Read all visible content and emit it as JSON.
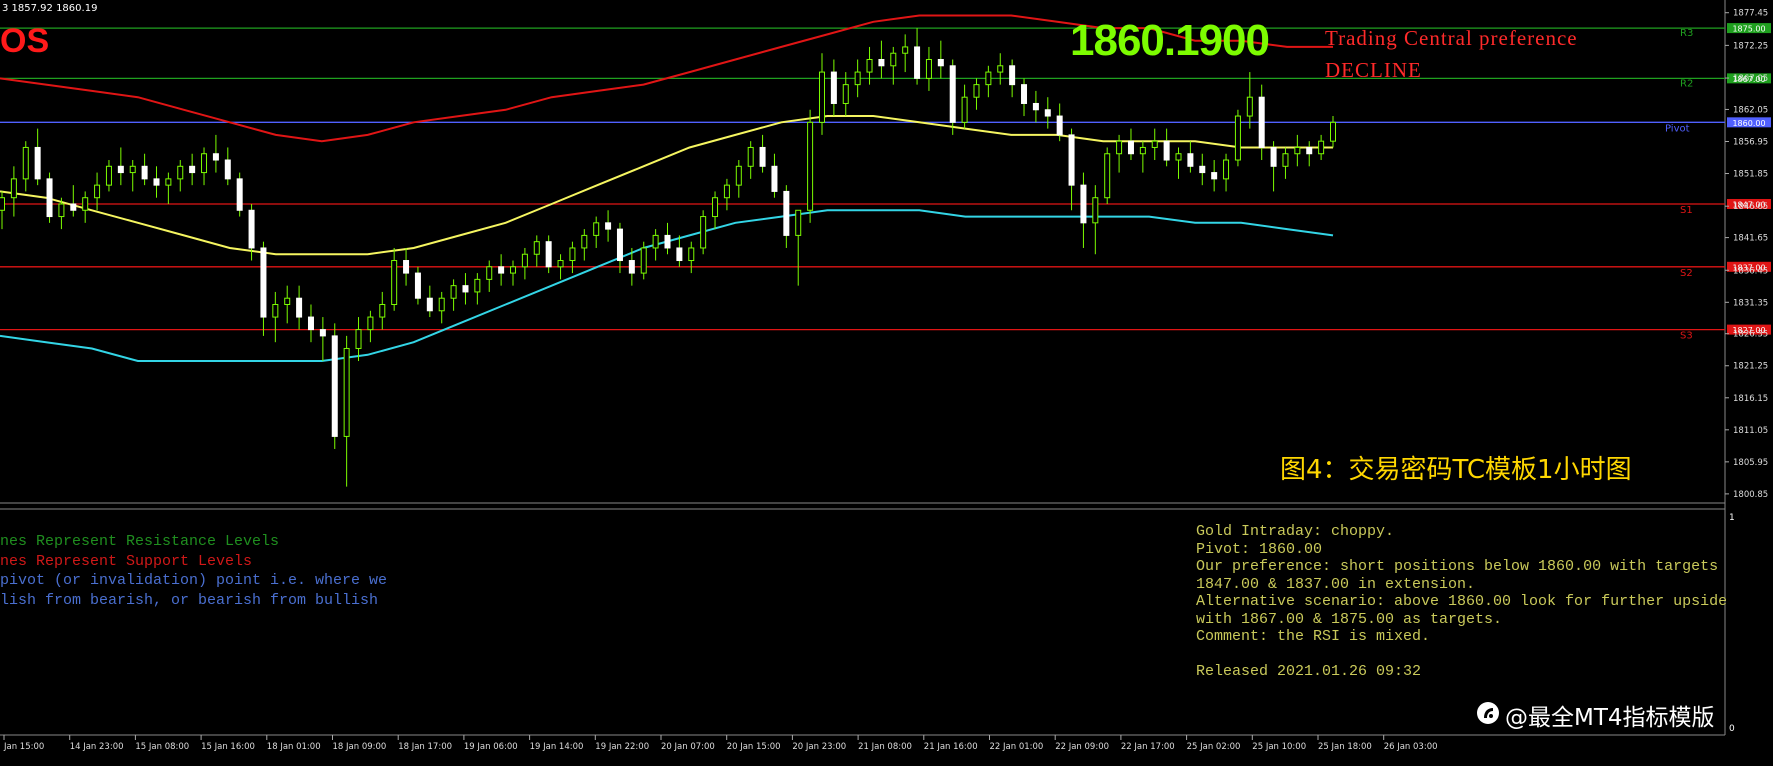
{
  "ohlc_readout": "3 1857.92 1860.19",
  "symbol_fragment": "OS",
  "current_price": "1860.1900",
  "preference": {
    "line1": "Trading Central preference",
    "line2": "DECLINE"
  },
  "figure_caption": "图4：交易密码TC模板1小时图",
  "watermark": "@最全MT4指标模版",
  "legend": [
    {
      "text": "nes Represent Resistance Levels",
      "color": "#1f8f1f"
    },
    {
      "text": "nes Represent Support Levels",
      "color": "#d01818"
    },
    {
      "text": "pivot (or invalidation) point i.e. where we",
      "color": "#4a6fd0"
    },
    {
      "text": "lish from bearish, or bearish from bullish",
      "color": "#4a6fd0"
    }
  ],
  "commentary": [
    "Gold Intraday: choppy.",
    "Pivot: 1860.00",
    "Our preference: short positions below 1860.00 with targets",
    "1847.00 & 1837.00 in extension.",
    "Alternative scenario: above 1860.00 look for further upside",
    "with 1867.00 & 1875.00 as targets.",
    "Comment: the RSI is mixed.",
    "",
    "Released 2021.01.26 09:32"
  ],
  "indicator_panel_scale": {
    "top": "1",
    "bottom": "0"
  },
  "colors": {
    "resistance": "#1fa01f",
    "support": "#e01515",
    "pivot": "#5060ff",
    "band_upper": "#e01515",
    "band_middle": "#f5f560",
    "band_lower": "#33d5e6",
    "price_label": "#7cfc00",
    "caption": "#ffd700",
    "commentary": "#c9c95a"
  },
  "chart_data": {
    "type": "candlestick",
    "title": "",
    "ylim": [
      1799.4,
      1878.2
    ],
    "y_ticks": [
      "1877.45",
      "1872.25",
      "1867.05",
      "1862.05",
      "1856.95",
      "1851.85",
      "1846.65",
      "1841.65",
      "1836.45",
      "1831.35",
      "1826.35",
      "1821.25",
      "1816.15",
      "1811.05",
      "1805.95",
      "1800.85"
    ],
    "x_ticks": [
      "Jan 15:00",
      "14 Jan 23:00",
      "15 Jan 08:00",
      "15 Jan 16:00",
      "18 Jan 01:00",
      "18 Jan 09:00",
      "18 Jan 17:00",
      "19 Jan 06:00",
      "19 Jan 14:00",
      "19 Jan 22:00",
      "20 Jan 07:00",
      "20 Jan 15:00",
      "20 Jan 23:00",
      "21 Jan 08:00",
      "21 Jan 16:00",
      "22 Jan 01:00",
      "22 Jan 09:00",
      "22 Jan 17:00",
      "25 Jan 02:00",
      "25 Jan 10:00",
      "25 Jan 18:00",
      "26 Jan 03:00"
    ],
    "levels": [
      {
        "name": "R3",
        "value": 1875.0,
        "type": "resistance",
        "axis_label": "1875.00"
      },
      {
        "name": "R2",
        "value": 1867.0,
        "type": "resistance",
        "axis_label": "1867.00"
      },
      {
        "name": "Pivot",
        "value": 1860.0,
        "type": "pivot",
        "axis_label": "1860.00"
      },
      {
        "name": "S1",
        "value": 1847.0,
        "type": "support",
        "axis_label": "1847.00"
      },
      {
        "name": "S2",
        "value": 1837.0,
        "type": "support",
        "axis_label": "1837.00"
      },
      {
        "name": "S3",
        "value": 1827.0,
        "type": "support",
        "axis_label": "1827.00"
      }
    ],
    "candles_ohlc": [
      [
        1846,
        1849,
        1843,
        1848
      ],
      [
        1848,
        1853,
        1845,
        1851
      ],
      [
        1851,
        1857,
        1849,
        1856
      ],
      [
        1856,
        1859,
        1850,
        1851
      ],
      [
        1851,
        1852,
        1844,
        1845
      ],
      [
        1845,
        1848,
        1843,
        1847
      ],
      [
        1847,
        1850,
        1845,
        1846
      ],
      [
        1846,
        1849,
        1844,
        1848
      ],
      [
        1848,
        1852,
        1846,
        1850
      ],
      [
        1850,
        1854,
        1849,
        1853
      ],
      [
        1853,
        1856,
        1850,
        1852
      ],
      [
        1852,
        1854,
        1849,
        1853
      ],
      [
        1853,
        1855,
        1850,
        1851
      ],
      [
        1851,
        1853,
        1848,
        1850
      ],
      [
        1850,
        1852,
        1847,
        1851
      ],
      [
        1851,
        1854,
        1849,
        1853
      ],
      [
        1853,
        1855,
        1850,
        1852
      ],
      [
        1852,
        1856,
        1850,
        1855
      ],
      [
        1855,
        1858,
        1852,
        1854
      ],
      [
        1854,
        1856,
        1850,
        1851
      ],
      [
        1851,
        1852,
        1845,
        1846
      ],
      [
        1846,
        1847,
        1838,
        1840
      ],
      [
        1840,
        1841,
        1826,
        1829
      ],
      [
        1829,
        1833,
        1825,
        1831
      ],
      [
        1831,
        1834,
        1828,
        1832
      ],
      [
        1832,
        1834,
        1827,
        1829
      ],
      [
        1829,
        1831,
        1825,
        1827
      ],
      [
        1827,
        1829,
        1822,
        1826
      ],
      [
        1826,
        1828,
        1808,
        1810
      ],
      [
        1810,
        1826,
        1802,
        1824
      ],
      [
        1824,
        1829,
        1822,
        1827
      ],
      [
        1827,
        1830,
        1825,
        1829
      ],
      [
        1829,
        1833,
        1827,
        1831
      ],
      [
        1831,
        1840,
        1830,
        1838
      ],
      [
        1838,
        1840,
        1834,
        1836
      ],
      [
        1836,
        1837,
        1831,
        1832
      ],
      [
        1832,
        1834,
        1829,
        1830
      ],
      [
        1830,
        1833,
        1828,
        1832
      ],
      [
        1832,
        1835,
        1830,
        1834
      ],
      [
        1834,
        1836,
        1831,
        1833
      ],
      [
        1833,
        1836,
        1831,
        1835
      ],
      [
        1835,
        1838,
        1833,
        1837
      ],
      [
        1837,
        1839,
        1834,
        1836
      ],
      [
        1836,
        1838,
        1834,
        1837
      ],
      [
        1837,
        1840,
        1835,
        1839
      ],
      [
        1839,
        1842,
        1837,
        1841
      ],
      [
        1841,
        1842,
        1836,
        1837
      ],
      [
        1837,
        1839,
        1835,
        1838
      ],
      [
        1838,
        1841,
        1836,
        1840
      ],
      [
        1840,
        1843,
        1838,
        1842
      ],
      [
        1842,
        1845,
        1840,
        1844
      ],
      [
        1844,
        1846,
        1841,
        1843
      ],
      [
        1843,
        1844,
        1836,
        1838
      ],
      [
        1838,
        1840,
        1834,
        1836
      ],
      [
        1836,
        1841,
        1835,
        1840
      ],
      [
        1840,
        1843,
        1838,
        1842
      ],
      [
        1842,
        1844,
        1839,
        1840
      ],
      [
        1840,
        1842,
        1837,
        1838
      ],
      [
        1838,
        1841,
        1836,
        1840
      ],
      [
        1840,
        1846,
        1839,
        1845
      ],
      [
        1845,
        1849,
        1843,
        1848
      ],
      [
        1848,
        1851,
        1846,
        1850
      ],
      [
        1850,
        1854,
        1848,
        1853
      ],
      [
        1853,
        1857,
        1851,
        1856
      ],
      [
        1856,
        1858,
        1852,
        1853
      ],
      [
        1853,
        1855,
        1848,
        1849
      ],
      [
        1849,
        1850,
        1840,
        1842
      ],
      [
        1842,
        1844,
        1834,
        1846
      ],
      [
        1846,
        1862,
        1844,
        1860
      ],
      [
        1860,
        1871,
        1858,
        1868
      ],
      [
        1868,
        1870,
        1861,
        1863
      ],
      [
        1863,
        1868,
        1861,
        1866
      ],
      [
        1866,
        1870,
        1864,
        1868
      ],
      [
        1868,
        1872,
        1866,
        1870
      ],
      [
        1870,
        1873,
        1867,
        1869
      ],
      [
        1869,
        1872,
        1866,
        1871
      ],
      [
        1871,
        1874,
        1868,
        1872
      ],
      [
        1872,
        1875,
        1866,
        1867
      ],
      [
        1867,
        1872,
        1865,
        1870
      ],
      [
        1870,
        1873,
        1867,
        1869
      ],
      [
        1869,
        1870,
        1858,
        1860
      ],
      [
        1860,
        1866,
        1859,
        1864
      ],
      [
        1864,
        1867,
        1862,
        1866
      ],
      [
        1866,
        1869,
        1864,
        1868
      ],
      [
        1868,
        1871,
        1866,
        1869
      ],
      [
        1869,
        1870,
        1864,
        1866
      ],
      [
        1866,
        1867,
        1861,
        1863
      ],
      [
        1863,
        1865,
        1860,
        1862
      ],
      [
        1862,
        1864,
        1859,
        1861
      ],
      [
        1861,
        1863,
        1857,
        1858
      ],
      [
        1858,
        1859,
        1846,
        1850
      ],
      [
        1850,
        1852,
        1840,
        1844
      ],
      [
        1844,
        1850,
        1839,
        1848
      ],
      [
        1848,
        1856,
        1847,
        1855
      ],
      [
        1855,
        1858,
        1852,
        1857
      ],
      [
        1857,
        1859,
        1854,
        1855
      ],
      [
        1855,
        1857,
        1852,
        1856
      ],
      [
        1856,
        1859,
        1854,
        1857
      ],
      [
        1857,
        1859,
        1853,
        1854
      ],
      [
        1854,
        1856,
        1851,
        1855
      ],
      [
        1855,
        1857,
        1852,
        1853
      ],
      [
        1853,
        1855,
        1850,
        1852
      ],
      [
        1852,
        1854,
        1849,
        1851
      ],
      [
        1851,
        1855,
        1849,
        1854
      ],
      [
        1854,
        1862,
        1853,
        1861
      ],
      [
        1861,
        1868,
        1859,
        1864
      ],
      [
        1864,
        1866,
        1854,
        1856
      ],
      [
        1856,
        1857,
        1849,
        1853
      ],
      [
        1853,
        1856,
        1851,
        1855
      ],
      [
        1855,
        1858,
        1853,
        1856
      ],
      [
        1856,
        1857,
        1853,
        1855
      ],
      [
        1855,
        1858,
        1854,
        1857
      ],
      [
        1857,
        1861,
        1856,
        1860
      ]
    ],
    "bands": {
      "upper": [
        1867,
        1866,
        1865,
        1864,
        1862,
        1860,
        1858,
        1857,
        1858,
        1860,
        1861,
        1862,
        1864,
        1865,
        1866,
        1868,
        1870,
        1872,
        1874,
        1876,
        1877,
        1877,
        1877,
        1876,
        1875,
        1875,
        1873,
        1873,
        1872,
        1872
      ],
      "middle": [
        1849,
        1848,
        1846,
        1844,
        1842,
        1840,
        1839,
        1839,
        1839,
        1840,
        1842,
        1844,
        1847,
        1850,
        1853,
        1856,
        1858,
        1860,
        1861,
        1861,
        1860,
        1859,
        1858,
        1858,
        1857,
        1857,
        1857,
        1856,
        1856,
        1856
      ],
      "lower": [
        1826,
        1825,
        1824,
        1822,
        1822,
        1822,
        1822,
        1822,
        1823,
        1825,
        1828,
        1831,
        1834,
        1837,
        1840,
        1842,
        1844,
        1845,
        1846,
        1846,
        1846,
        1845,
        1845,
        1845,
        1845,
        1845,
        1844,
        1844,
        1843,
        1842
      ]
    }
  }
}
